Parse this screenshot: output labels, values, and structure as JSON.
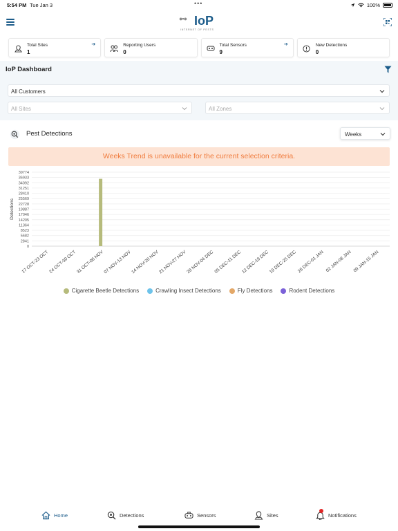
{
  "status_bar": {
    "time": "5:54 PM",
    "date": "Tue Jan 3",
    "battery": "100%"
  },
  "header": {
    "logo_text": "IoP",
    "logo_tagline": "INTERNET OF PESTS"
  },
  "stats": [
    {
      "label": "Total Sites",
      "value": "1",
      "has_link": true,
      "icon": "sites-icon"
    },
    {
      "label": "Reporting Users",
      "value": "0",
      "has_link": false,
      "icon": "users-icon"
    },
    {
      "label": "Total Sensors",
      "value": "9",
      "has_link": true,
      "icon": "sensor-icon"
    },
    {
      "label": "New Detections",
      "value": "0",
      "has_link": false,
      "icon": "alert-icon"
    }
  ],
  "dashboard": {
    "title": "IoP Dashboard",
    "customers_select": "All Customers",
    "sites_select": "All Sites",
    "zones_select": "All Zones"
  },
  "detections": {
    "title": "Pest Detections",
    "period_select": "Weeks",
    "banner": "Weeks Trend is unavailable for the current selection criteria."
  },
  "colors": {
    "brand": "#1c5c8a",
    "banner_bg": "#fde3d4",
    "banner_text": "#f07c3e"
  },
  "chart_data": {
    "type": "bar",
    "ylabel": "Detections",
    "ylim": [
      0,
      39774
    ],
    "yticks": [
      "39774",
      "36933",
      "34092",
      "31251",
      "28410",
      "25569",
      "22728",
      "19887",
      "17046",
      "14205",
      "11364",
      "8523",
      "5682",
      "2841",
      "0"
    ],
    "categories": [
      "17 OCT-23 OCT",
      "24 OCT-30 OCT",
      "31 OCT-06 NOV",
      "07 NOV-13 NOV",
      "14 NOV-20 NOV",
      "21 NOV-27 NOV",
      "28 NOV-04 DEC",
      "05 DEC-11 DEC",
      "12 DEC-18 DEC",
      "19 DEC-25 DEC",
      "26 DEC-01 JAN",
      "02 JAN-08 JAN",
      "09 JAN-15 JAN"
    ],
    "series": [
      {
        "name": "Cigarette Beetle Detections",
        "color": "#b6bb7c",
        "values": [
          0,
          0,
          36200,
          0,
          0,
          0,
          0,
          0,
          0,
          0,
          0,
          0,
          0
        ]
      },
      {
        "name": "Crawling Insect Detections",
        "color": "#6ec3ea",
        "values": [
          0,
          0,
          0,
          0,
          0,
          0,
          0,
          0,
          0,
          0,
          0,
          0,
          0
        ]
      },
      {
        "name": "Fly Detections",
        "color": "#e3a868",
        "values": [
          0,
          0,
          0,
          0,
          0,
          0,
          0,
          0,
          0,
          0,
          0,
          0,
          0
        ]
      },
      {
        "name": "Rodent Detections",
        "color": "#7b61d8",
        "values": [
          0,
          0,
          0,
          0,
          0,
          0,
          0,
          0,
          0,
          0,
          0,
          0,
          0
        ]
      }
    ],
    "grid": true,
    "legend_position": "bottom"
  },
  "tabs": [
    {
      "label": "Home",
      "active": true
    },
    {
      "label": "Detections",
      "active": false
    },
    {
      "label": "Sensors",
      "active": false
    },
    {
      "label": "Sites",
      "active": false
    },
    {
      "label": "Notifications",
      "active": false
    }
  ]
}
